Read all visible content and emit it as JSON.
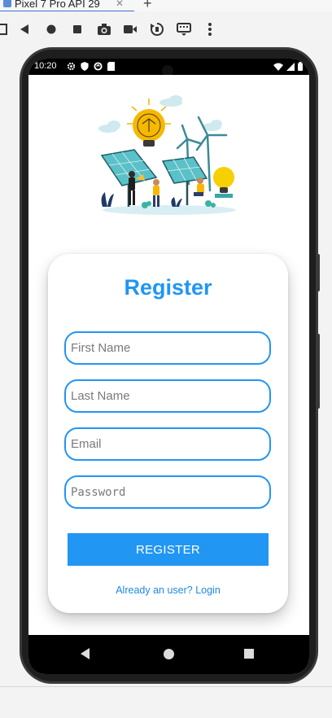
{
  "emulator": {
    "tab_title": "Pixel 7 Pro API 29",
    "close_glyph": "✕",
    "new_tab_glyph": "+",
    "toolbar_icons": [
      "device-frame-icon",
      "back-icon",
      "home-icon",
      "overview-icon",
      "camera-icon",
      "video-icon",
      "rotate-icon",
      "keyboard-icon",
      "more-icon"
    ]
  },
  "status_bar": {
    "time": "10:20",
    "left_icons": [
      "settings-icon",
      "shield-icon",
      "data-saver-icon",
      "sd-card-icon"
    ],
    "right_icons": [
      "wifi-icon",
      "signal-icon",
      "battery-icon"
    ]
  },
  "register": {
    "title": "Register",
    "first_name_placeholder": "First Name",
    "last_name_placeholder": "Last Name",
    "email_placeholder": "Email",
    "password_placeholder": "Password",
    "button_label": "REGISTER",
    "login_link": "Already an user? Login"
  },
  "colors": {
    "accent": "#2196f3",
    "link": "#1e88e5"
  },
  "nav_bar": {
    "icons": [
      "nav-back-icon",
      "nav-home-icon",
      "nav-recents-icon"
    ]
  }
}
